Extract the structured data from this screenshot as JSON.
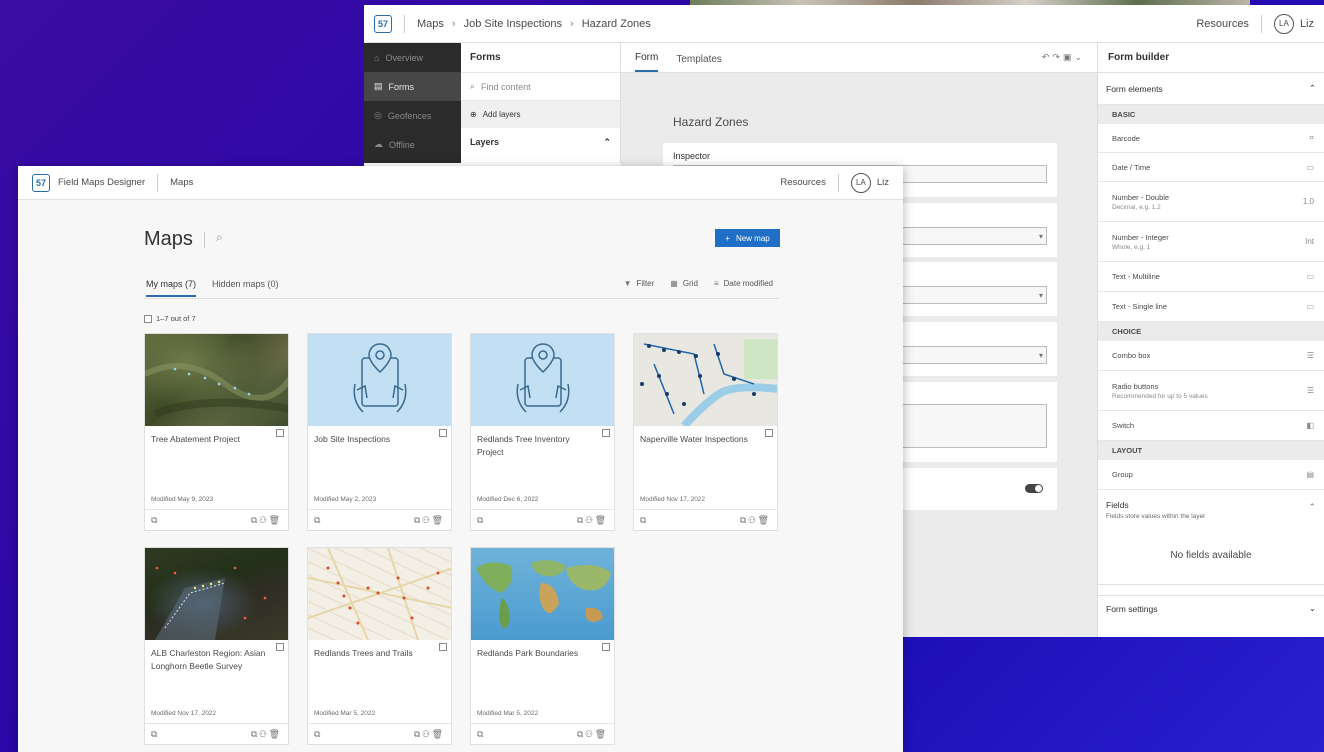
{
  "back": {
    "crumbs": [
      "Maps",
      "Job Site Inspections",
      "Hazard Zones"
    ],
    "resources": "Resources",
    "avatar": "LA",
    "user": "Liz",
    "nav": [
      "Overview",
      "Forms",
      "Geofences",
      "Offline"
    ],
    "forms_panel": {
      "title": "Forms",
      "search_placeholder": "Find content",
      "add_layers": "Add layers",
      "layers": "Layers"
    },
    "tabs": [
      "Form",
      "Templates"
    ],
    "form_title": "Hazard Zones",
    "inspector_label": "Inspector",
    "builder": {
      "title": "Form builder",
      "elements_label": "Form elements",
      "basic": "BASIC",
      "choice": "CHOICE",
      "layout": "LAYOUT",
      "barcode": "Barcode",
      "datetime": "Date / Time",
      "number_double": "Number - Double",
      "number_double_sub": "Decimal, e.g. 1.2",
      "number_integer": "Number - Integer",
      "number_integer_sub": "Whole, e.g. 1",
      "text_multiline": "Text - Multiline",
      "text_single": "Text - Single line",
      "combo": "Combo box",
      "radio": "Radio buttons",
      "radio_sub": "Recommended for up to 5 values",
      "switch": "Switch",
      "group": "Group",
      "fields_label": "Fields",
      "fields_sub": "Fields store values within the layer",
      "no_fields": "No fields available",
      "form_settings": "Form settings"
    }
  },
  "front": {
    "app_name": "Field Maps Designer",
    "section": "Maps",
    "resources": "Resources",
    "avatar": "LA",
    "user": "Liz",
    "page_title": "Maps",
    "new_map": "New map",
    "tabs": {
      "my_maps": "My maps (7)",
      "hidden_maps": "Hidden maps (0)"
    },
    "toolbar": {
      "filter": "Filter",
      "grid": "Grid",
      "sort": "Date modified"
    },
    "count": "1–7 out of 7",
    "maps": [
      {
        "name": "Tree Abatement Project",
        "modified": "Modified May 9, 2023"
      },
      {
        "name": "Job Site Inspections",
        "modified": "Modified May 2, 2023"
      },
      {
        "name": "Redlands Tree Inventory Project",
        "modified": "Modified Dec 6, 2022"
      },
      {
        "name": "Naperville Water Inspections",
        "modified": "Modified Nov 17, 2022"
      },
      {
        "name": "ALB Charleston Region: Asian Longhorn Beetle Survey",
        "modified": "Modified Nov 17, 2022"
      },
      {
        "name": "Redlands Trees and Trails",
        "modified": "Modified Mar 5, 2022"
      },
      {
        "name": "Redlands Park Boundaries",
        "modified": "Modified Mar 5, 2022"
      }
    ]
  }
}
